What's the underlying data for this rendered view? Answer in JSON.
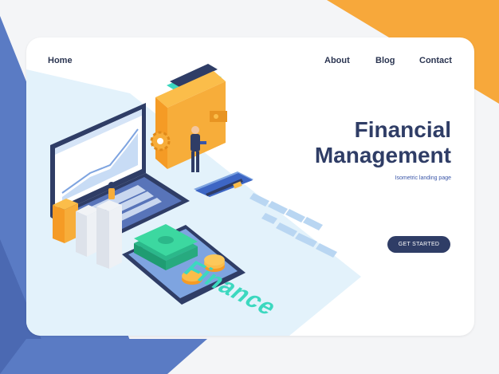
{
  "nav": {
    "home": "Home",
    "about": "About",
    "blog": "Blog",
    "contact": "Contact"
  },
  "hero": {
    "title_line1": "Financial",
    "title_line2": "Management",
    "subtitle": "Isometric landing page",
    "cta_label": "GET STARTED"
  },
  "illustration": {
    "word": "Finance",
    "icons": [
      "laptop-icon",
      "wallet-icon",
      "credit-card-icon",
      "smartphone-icon",
      "money-stack-icon",
      "coin-icon",
      "gear-icon",
      "bar-chart-icon",
      "businessman-icon"
    ]
  },
  "colors": {
    "navy": "#2f3d66",
    "teal": "#3cd8bf",
    "orange": "#f7a83b",
    "blue_bg": "#5a7bc4",
    "light_blue": "#e3f2fb"
  }
}
